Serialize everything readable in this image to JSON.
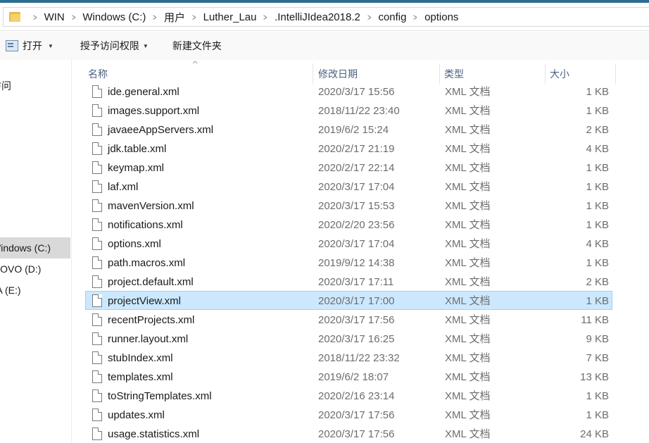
{
  "breadcrumb": [
    "WIN",
    "Windows (C:)",
    "用户",
    "Luther_Lau",
    ".IntelliJIdea2018.2",
    "config",
    "options"
  ],
  "breadcrumb_separator": ">",
  "toolbar": {
    "open_label": "打开",
    "grant_label": "授予访问权限",
    "new_folder_label": "新建文件夹",
    "dropdown_caret": "▼"
  },
  "sidebar": {
    "items": [
      "访问",
      "Windows (C:)",
      "NOVO (D:)",
      "TA (E:)"
    ]
  },
  "columns": {
    "name": "名称",
    "date": "修改日期",
    "type": "类型",
    "size": "大小",
    "sort_caret": "^"
  },
  "files": [
    {
      "name": "ide.general.xml",
      "date": "2020/3/17 15:56",
      "type": "XML 文档",
      "size": "1 KB"
    },
    {
      "name": "images.support.xml",
      "date": "2018/11/22 23:40",
      "type": "XML 文档",
      "size": "1 KB"
    },
    {
      "name": "javaeeAppServers.xml",
      "date": "2019/6/2 15:24",
      "type": "XML 文档",
      "size": "2 KB"
    },
    {
      "name": "jdk.table.xml",
      "date": "2020/2/17 21:19",
      "type": "XML 文档",
      "size": "4 KB"
    },
    {
      "name": "keymap.xml",
      "date": "2020/2/17 22:14",
      "type": "XML 文档",
      "size": "1 KB"
    },
    {
      "name": "laf.xml",
      "date": "2020/3/17 17:04",
      "type": "XML 文档",
      "size": "1 KB"
    },
    {
      "name": "mavenVersion.xml",
      "date": "2020/3/17 15:53",
      "type": "XML 文档",
      "size": "1 KB"
    },
    {
      "name": "notifications.xml",
      "date": "2020/2/20 23:56",
      "type": "XML 文档",
      "size": "1 KB"
    },
    {
      "name": "options.xml",
      "date": "2020/3/17 17:04",
      "type": "XML 文档",
      "size": "4 KB"
    },
    {
      "name": "path.macros.xml",
      "date": "2019/9/12 14:38",
      "type": "XML 文档",
      "size": "1 KB"
    },
    {
      "name": "project.default.xml",
      "date": "2020/3/17 17:11",
      "type": "XML 文档",
      "size": "2 KB"
    },
    {
      "name": "projectView.xml",
      "date": "2020/3/17 17:00",
      "type": "XML 文档",
      "size": "1 KB"
    },
    {
      "name": "recentProjects.xml",
      "date": "2020/3/17 17:56",
      "type": "XML 文档",
      "size": "11 KB"
    },
    {
      "name": "runner.layout.xml",
      "date": "2020/3/17 16:25",
      "type": "XML 文档",
      "size": "9 KB"
    },
    {
      "name": "stubIndex.xml",
      "date": "2018/11/22 23:32",
      "type": "XML 文档",
      "size": "7 KB"
    },
    {
      "name": "templates.xml",
      "date": "2019/6/2 18:07",
      "type": "XML 文档",
      "size": "13 KB"
    },
    {
      "name": "toStringTemplates.xml",
      "date": "2020/2/16 23:14",
      "type": "XML 文档",
      "size": "1 KB"
    },
    {
      "name": "updates.xml",
      "date": "2020/3/17 17:56",
      "type": "XML 文档",
      "size": "1 KB"
    },
    {
      "name": "usage.statistics.xml",
      "date": "2020/3/17 17:56",
      "type": "XML 文档",
      "size": "24 KB"
    }
  ],
  "selected_file_index": 11,
  "selected_sidebar_index": 1,
  "colors": {
    "selection_bg": "#cce8ff",
    "selection_border": "#99d1ff",
    "header_text": "#4d6082",
    "secondary_text": "#6d6d6d",
    "folder_icon": "#f5d36b"
  }
}
